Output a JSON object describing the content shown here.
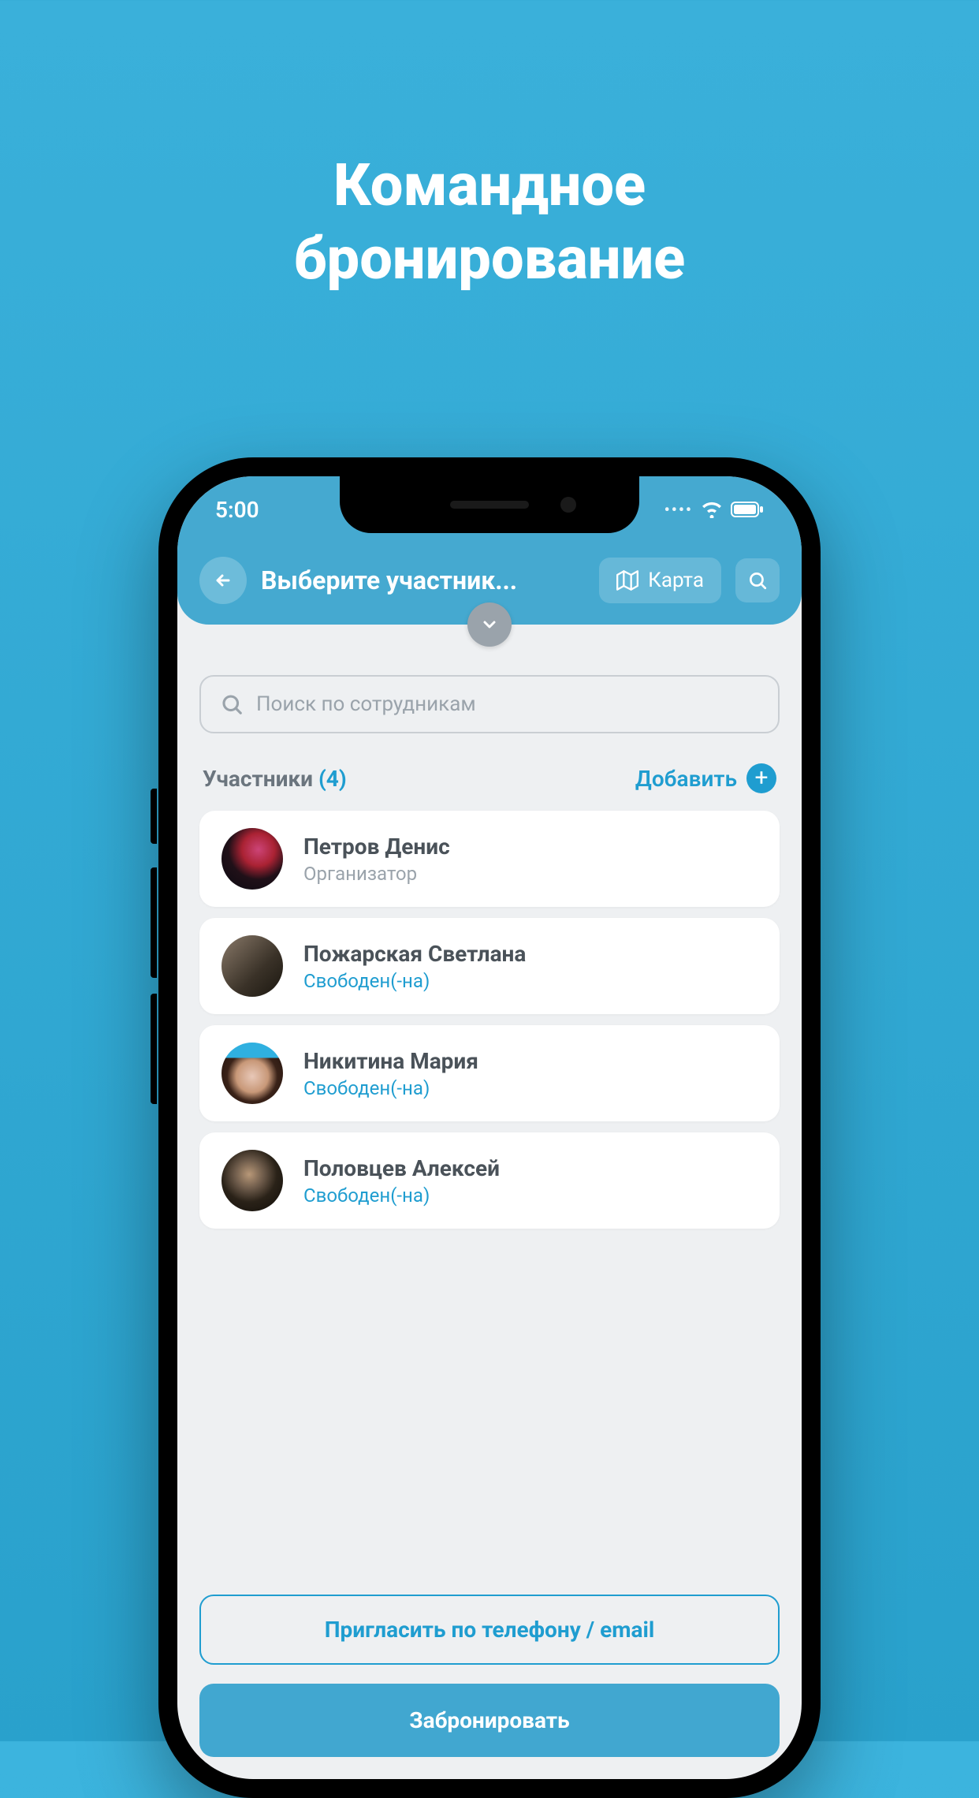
{
  "promo": {
    "line1": "Командное",
    "line2": "бронирование"
  },
  "status": {
    "time": "5:00"
  },
  "header": {
    "title": "Выберите участник...",
    "map_label": "Карта"
  },
  "search": {
    "placeholder": "Поиск по сотрудникам"
  },
  "section": {
    "label": "Участники",
    "count": "(4)",
    "add_label": "Добавить"
  },
  "participants": [
    {
      "name": "Петров Денис",
      "role": "Организатор",
      "status": null
    },
    {
      "name": "Пожарская Светлана",
      "role": null,
      "status": "Свободен(-на)"
    },
    {
      "name": "Никитина Мария",
      "role": null,
      "status": "Свободен(-на)"
    },
    {
      "name": "Половцев Алексей",
      "role": null,
      "status": "Свободен(-на)"
    }
  ],
  "footer": {
    "invite_label": "Пригласить по телефону / email",
    "book_label": "Забронировать"
  }
}
